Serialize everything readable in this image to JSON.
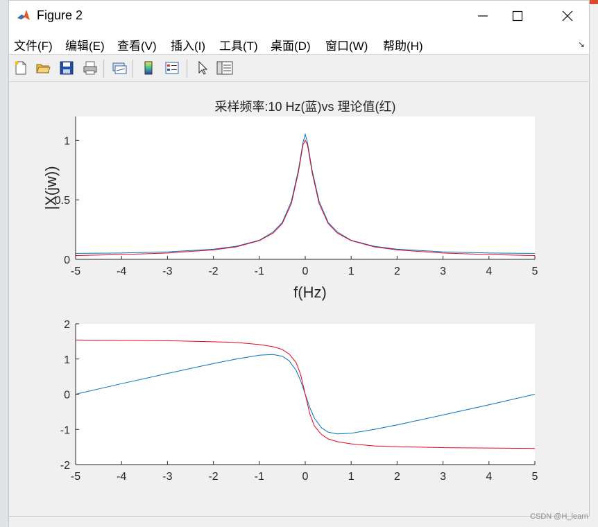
{
  "window": {
    "title": "Figure 2"
  },
  "menu": [
    "文件(F)",
    "编辑(E)",
    "查看(V)",
    "插入(I)",
    "工具(T)",
    "桌面(D)",
    "窗口(W)",
    "帮助(H)"
  ],
  "toolbar": [
    "new-figure-icon",
    "open-file-icon",
    "save-icon",
    "print-icon",
    "link-plot-icon",
    "colorbar-icon",
    "legend-icon",
    "pointer-icon",
    "property-inspector-icon"
  ],
  "colors": {
    "series_blue": "#0072bd",
    "series_red": "#e8001f"
  },
  "chart_data": [
    {
      "type": "line",
      "title": "采样频率:10 Hz(蓝)vs 理论值(红)",
      "xlabel": "f(Hz)",
      "ylabel": "|X(jw))",
      "xlim": [
        -5,
        5
      ],
      "ylim": [
        0,
        1.2
      ],
      "xticks": [
        "-5",
        "-4",
        "-3",
        "-2",
        "-1",
        "0",
        "1",
        "2",
        "3",
        "4",
        "5"
      ],
      "yticks": [
        "0",
        "0.5",
        "1"
      ],
      "grid": false,
      "series": [
        {
          "color": "#0072bd",
          "x": [
            -5,
            -4,
            -3,
            -2,
            -1.5,
            -1,
            -0.7,
            -0.5,
            -0.3,
            -0.15,
            -0.05,
            0,
            0.05,
            0.15,
            0.3,
            0.5,
            0.7,
            1,
            1.5,
            2,
            3,
            4,
            5
          ],
          "values": [
            0.05,
            0.053,
            0.063,
            0.085,
            0.11,
            0.16,
            0.23,
            0.31,
            0.49,
            0.75,
            0.98,
            1.05,
            0.98,
            0.75,
            0.49,
            0.31,
            0.23,
            0.16,
            0.11,
            0.085,
            0.063,
            0.053,
            0.05
          ]
        },
        {
          "color": "#e8001f",
          "x": [
            -5,
            -4,
            -3,
            -2,
            -1.5,
            -1,
            -0.7,
            -0.5,
            -0.3,
            -0.15,
            -0.05,
            0,
            0.05,
            0.15,
            0.3,
            0.5,
            0.7,
            1,
            1.5,
            2,
            3,
            4,
            5
          ],
          "values": [
            0.032,
            0.04,
            0.053,
            0.079,
            0.105,
            0.157,
            0.22,
            0.3,
            0.47,
            0.73,
            0.96,
            1.0,
            0.96,
            0.73,
            0.47,
            0.3,
            0.22,
            0.157,
            0.105,
            0.079,
            0.053,
            0.04,
            0.032
          ]
        }
      ]
    },
    {
      "type": "line",
      "title": "",
      "xlabel": "",
      "ylabel": "",
      "xlim": [
        -5,
        5
      ],
      "ylim": [
        -2,
        2
      ],
      "xticks": [
        "-5",
        "-4",
        "-3",
        "-2",
        "-1",
        "0",
        "1",
        "2",
        "3",
        "4",
        "5"
      ],
      "yticks": [
        "-2",
        "-1",
        "0",
        "1",
        "2"
      ],
      "grid": false,
      "series": [
        {
          "color": "#0072bd",
          "x": [
            -5,
            -4,
            -3,
            -2,
            -1.5,
            -1,
            -0.7,
            -0.5,
            -0.35,
            -0.2,
            -0.1,
            0,
            0.1,
            0.2,
            0.35,
            0.5,
            0.7,
            1,
            1.5,
            2,
            3,
            4,
            5
          ],
          "values": [
            0,
            0.3,
            0.59,
            0.87,
            1.0,
            1.11,
            1.13,
            1.08,
            0.95,
            0.68,
            0.38,
            0,
            -0.38,
            -0.68,
            -0.95,
            -1.08,
            -1.13,
            -1.11,
            -1.0,
            -0.87,
            -0.59,
            -0.3,
            0
          ]
        },
        {
          "color": "#e8001f",
          "x": [
            -5,
            -4,
            -3,
            -2,
            -1.5,
            -1,
            -0.7,
            -0.5,
            -0.35,
            -0.2,
            -0.1,
            0,
            0.1,
            0.2,
            0.35,
            0.5,
            0.7,
            1,
            1.5,
            2,
            3,
            4,
            5
          ],
          "values": [
            1.54,
            1.53,
            1.52,
            1.49,
            1.47,
            1.41,
            1.35,
            1.27,
            1.14,
            0.9,
            0.56,
            0,
            -0.56,
            -0.9,
            -1.14,
            -1.27,
            -1.35,
            -1.41,
            -1.47,
            -1.49,
            -1.52,
            -1.53,
            -1.54
          ]
        }
      ]
    }
  ],
  "watermark": "CSDN @H_learn"
}
